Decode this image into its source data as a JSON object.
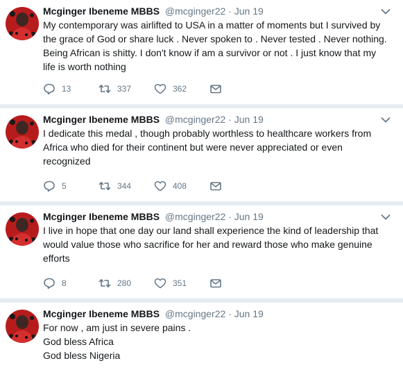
{
  "tweets": [
    {
      "name": "Mcginger Ibeneme MBBS",
      "handle": "@mcginger22",
      "separator": "·",
      "date": "Jun 19",
      "lines": [
        "My contemporary was airlifted to USA in a matter of moments but I survived by",
        "the grace of God or share luck . Never spoken to . Never tested . Never nothing.",
        "Being African is shitty. I don't know if am a survivor or not . I just know that my",
        "life is worth nothing"
      ],
      "replies": "13",
      "retweets": "337",
      "likes": "362"
    },
    {
      "name": "Mcginger Ibeneme MBBS",
      "handle": "@mcginger22",
      "separator": "·",
      "date": "Jun 19",
      "lines": [
        "I dedicate this medal , though probably worthless to healthcare workers from",
        "Africa who died for their continent but were never appreciated or even",
        "recognized"
      ],
      "replies": "5",
      "retweets": "344",
      "likes": "408"
    },
    {
      "name": "Mcginger Ibeneme MBBS",
      "handle": "@mcginger22",
      "separator": "·",
      "date": "Jun 19",
      "lines": [
        "I live in hope that one day our land shall experience the kind of leadership that",
        "would value those who sacrifice for her and reward those who make genuine",
        "efforts"
      ],
      "replies": "8",
      "retweets": "280",
      "likes": "351"
    },
    {
      "name": "Mcginger Ibeneme MBBS",
      "handle": "@mcginger22",
      "separator": "·",
      "date": "Jun 19",
      "lines": [
        "For now , am just in severe pains .",
        "God bless Africa",
        "God bless Nigeria"
      ]
    }
  ],
  "icons": {
    "reply": "reply-icon",
    "retweet": "retweet-icon",
    "like": "heart-icon",
    "dm": "envelope-icon",
    "more": "chevron-down-icon",
    "avatar": "avatar"
  },
  "colors": {
    "text": "#14171a",
    "secondary": "#657786",
    "divider": "#e6ecf0",
    "avatar_bg": "#c62828"
  }
}
